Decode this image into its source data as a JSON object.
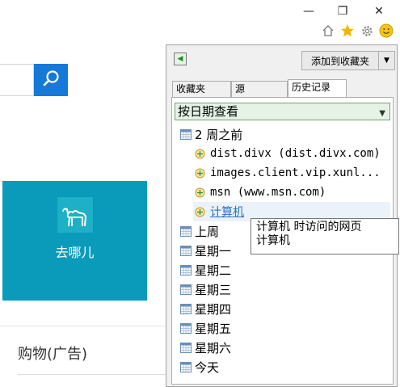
{
  "window_controls": {
    "minimize_label": "—",
    "restore_label": "❐",
    "close_label": "✕"
  },
  "toolbar": {
    "icons": [
      "home-icon",
      "favorites-star-icon",
      "settings-gear-icon",
      "smiley-feedback-icon"
    ]
  },
  "page": {
    "tile_label": "去哪儿",
    "shopping_label": "购物(广告)"
  },
  "favorites_pane": {
    "add_button_label": "添加到收藏夹",
    "tabs": [
      "收藏夹",
      "源",
      "历史记录"
    ],
    "active_tab": "历史记录",
    "view_select": "按日期查看",
    "history": {
      "group_two_weeks": "2 周之前",
      "sites": [
        "dist.divx (dist.divx.com)",
        "images.client.vip.xunl...",
        "msn (www.msn.com)",
        "计算机"
      ],
      "days": [
        "上周",
        "星期一",
        "星期二",
        "星期三",
        "星期四",
        "星期五",
        "星期六",
        "今天"
      ]
    },
    "tooltip": {
      "line1": "计算机 时访问的网页",
      "line2": "计算机"
    }
  },
  "colors": {
    "search_button": "#1679d8",
    "tile_background": "#0a9bbb",
    "star": "#f2b600",
    "link_hover": "#2a6fd0"
  }
}
